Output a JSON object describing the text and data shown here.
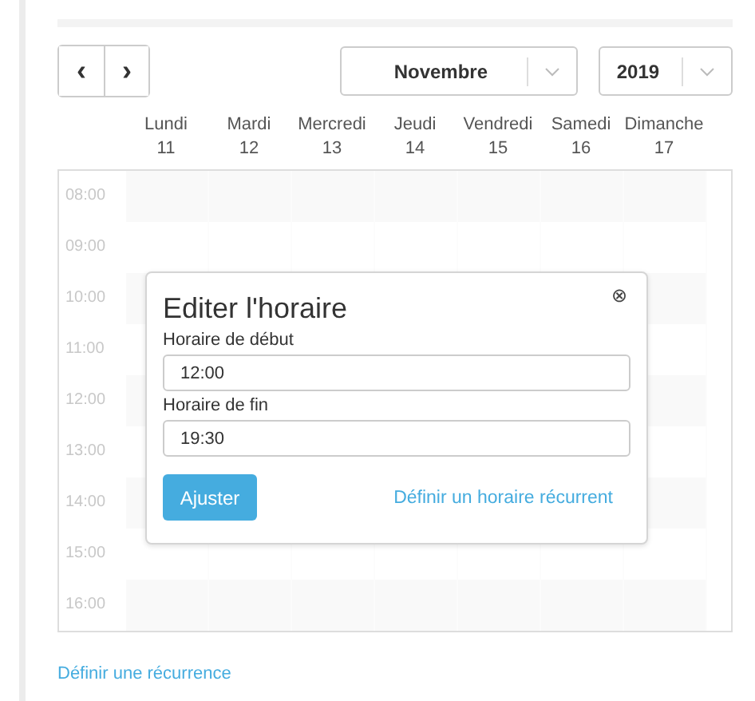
{
  "navigation": {
    "previous": "‹",
    "next": "›"
  },
  "month_select": {
    "value": "Novembre"
  },
  "year_select": {
    "value": "2019"
  },
  "days": [
    {
      "name": "Lundi",
      "date": "11"
    },
    {
      "name": "Mardi",
      "date": "12"
    },
    {
      "name": "Mercredi",
      "date": "13"
    },
    {
      "name": "Jeudi",
      "date": "14"
    },
    {
      "name": "Vendredi",
      "date": "15"
    },
    {
      "name": "Samedi",
      "date": "16"
    },
    {
      "name": "Dimanche",
      "date": "17"
    }
  ],
  "hours": [
    "08:00",
    "09:00",
    "10:00",
    "11:00",
    "12:00",
    "13:00",
    "14:00",
    "15:00",
    "16:00"
  ],
  "dialog": {
    "title": "Editer l'horaire",
    "close": "⊗",
    "fields": [
      {
        "label": "Horaire de début",
        "value": "12:00"
      },
      {
        "label": "Horaire de fin",
        "value": "19:30"
      }
    ],
    "button": "Ajuster",
    "link": "Définir un horaire récurrent"
  },
  "footer_link": "Définir une récurrence"
}
